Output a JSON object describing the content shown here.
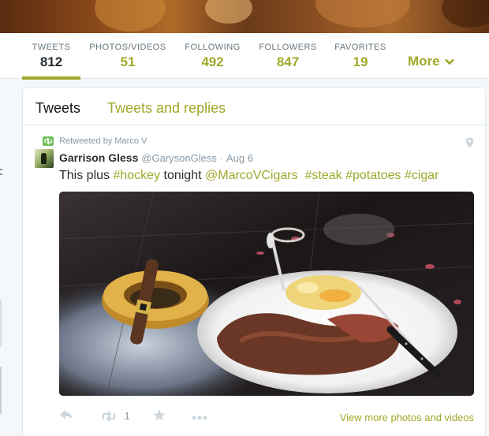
{
  "profile_nav": {
    "stats": [
      {
        "label": "TWEETS",
        "value": "812"
      },
      {
        "label": "PHOTOS/VIDEOS",
        "value": "51"
      },
      {
        "label": "FOLLOWING",
        "value": "492"
      },
      {
        "label": "FOLLOWERS",
        "value": "847"
      },
      {
        "label": "FAVORITES",
        "value": "19"
      }
    ],
    "more_label": "More"
  },
  "timeline": {
    "tabs": [
      {
        "label": "Tweets"
      },
      {
        "label": "Tweets and replies"
      }
    ],
    "tweet": {
      "context": "Retweeted by Marco V",
      "fullname": "Garrison Gless",
      "username": "@GarysonGless",
      "separator": "·",
      "timestamp": "Aug 6",
      "text": {
        "t1": "This plus ",
        "h1": "#hockey",
        "t2": " tonight ",
        "h2": "@MarcoVCigars",
        "t3": "  ",
        "h3": "#steak",
        "t4": " ",
        "h4": "#potatoes",
        "t5": " ",
        "h5": "#cigar"
      },
      "retweet_count": "1",
      "view_more": "View more photos and videos"
    }
  },
  "colors": {
    "accent": "#a0a82a",
    "muted": "#8899a6",
    "text": "#292f33",
    "retweet_badge": "#6fbd5a"
  },
  "icons": {
    "retweet": "retweet-icon",
    "reply": "reply-icon",
    "favorite": "star-icon",
    "more": "ellipsis-icon",
    "location": "map-pin-icon",
    "chevron": "chevron-down-icon"
  }
}
